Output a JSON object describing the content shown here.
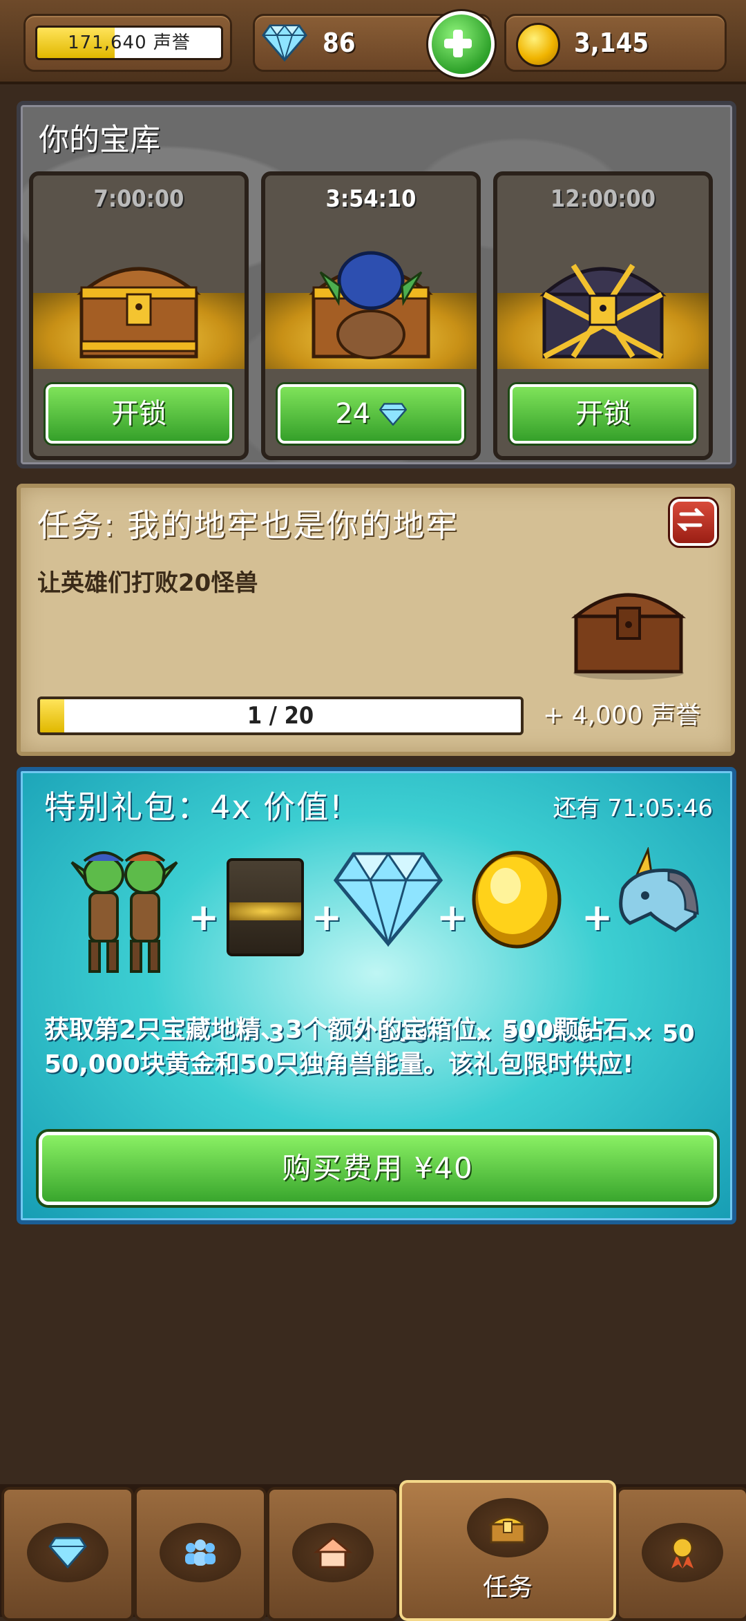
{
  "top_bar": {
    "reputation_text": "171,640 声誉",
    "reputation_progress": 0.42,
    "gems": "86",
    "gold": "3,145"
  },
  "vault": {
    "title": "你的宝库",
    "chests": [
      {
        "timer": "7:00:00",
        "button": "开锁",
        "state": "locked"
      },
      {
        "timer": "3:54:10",
        "button": "24",
        "state": "unlocking"
      },
      {
        "timer": "12:00:00",
        "button": "开锁",
        "state": "locked"
      }
    ]
  },
  "quest": {
    "title": "任务: 我的地牢也是你的地牢",
    "description": "让英雄们打败20怪兽",
    "progress_text": "1 / 20",
    "progress": 0.05,
    "reward": "+ 4,000 声誉"
  },
  "offer": {
    "title": "特别礼包：4x 价值!",
    "timer": "还有 71:05:46",
    "items": [
      {
        "icon": "goblins-icon",
        "qty": ""
      },
      {
        "icon": "chest-slot-icon",
        "qty": "× 3"
      },
      {
        "icon": "diamond-icon",
        "qty": "× 500"
      },
      {
        "icon": "gold-coin-icon",
        "qty": "× 50.000"
      },
      {
        "icon": "unicorn-icon",
        "qty": "× 50"
      }
    ],
    "plus": "+",
    "description": "获取第2只宝藏地精、3个额外的宝箱位、500颗钻石、50,000块黄金和50只独角兽能量。该礼包限时供应!",
    "buy_label": "购买费用 ¥40"
  },
  "nav": {
    "tabs": [
      {
        "icon": "shop-diamond-icon",
        "label": ""
      },
      {
        "icon": "heroes-icon",
        "label": ""
      },
      {
        "icon": "dungeon-icon",
        "label": ""
      },
      {
        "icon": "quests-chest-icon",
        "label": "任务",
        "active": true
      },
      {
        "icon": "achievements-medal-icon",
        "label": ""
      }
    ]
  },
  "colors": {
    "button_green": "#39a62d",
    "progress_yellow": "#e0b800",
    "offer_teal": "#3dcfd2",
    "wood_brown": "#6b4526"
  }
}
